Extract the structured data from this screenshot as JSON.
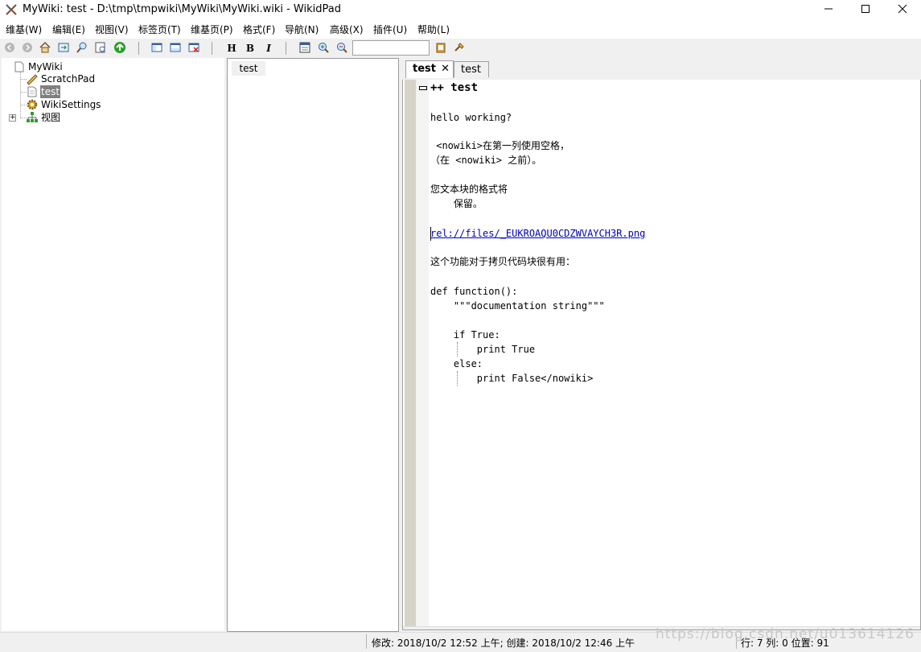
{
  "window": {
    "title": "MyWiki: test - D:\\tmp\\tmpwiki\\MyWiki\\MyWiki.wiki - WikidPad",
    "controls": [
      "minimize-icon",
      "maximize-icon",
      "close-icon"
    ]
  },
  "menu": {
    "items": [
      "维基(W)",
      "编辑(E)",
      "视图(V)",
      "标签页(T)",
      "维基页(P)",
      "格式(F)",
      "导航(N)",
      "高级(X)",
      "插件(U)",
      "帮助(L)"
    ]
  },
  "toolbar": {
    "bold_label": "H",
    "bold2_label": "B",
    "italic_label": "I",
    "search_value": ""
  },
  "tree": {
    "root": "MyWiki",
    "items": [
      "ScratchPad",
      "test",
      "WikiSettings",
      "视图"
    ],
    "selected": "test"
  },
  "docs": {
    "items": [
      "test"
    ]
  },
  "tabs": [
    {
      "label": "test",
      "active": true
    },
    {
      "label": "test",
      "active": false
    }
  ],
  "editor": {
    "lines": [
      "++ test",
      "hello working?",
      " <nowiki>在第一列使用空格，",
      "（在 <nowiki> 之前）。",
      "您文本块的格式将",
      "    保留。",
      "rel://files/_EUKROAQU0CDZWVAYCH3R.png",
      "这个功能对于拷贝代码块很有用：",
      "def function():",
      "    \"\"\"documentation string\"\"\"",
      "    if True:",
      "        print True",
      "    else:",
      "        print False</nowiki>"
    ]
  },
  "status": {
    "modified": "修改: 2018/10/2 12:52 上午; 创建: 2018/10/2 12:46 上午",
    "position": "行: 7 列: 0 位置: 91"
  },
  "watermark": "https://blog.csdn.net/u013614126"
}
